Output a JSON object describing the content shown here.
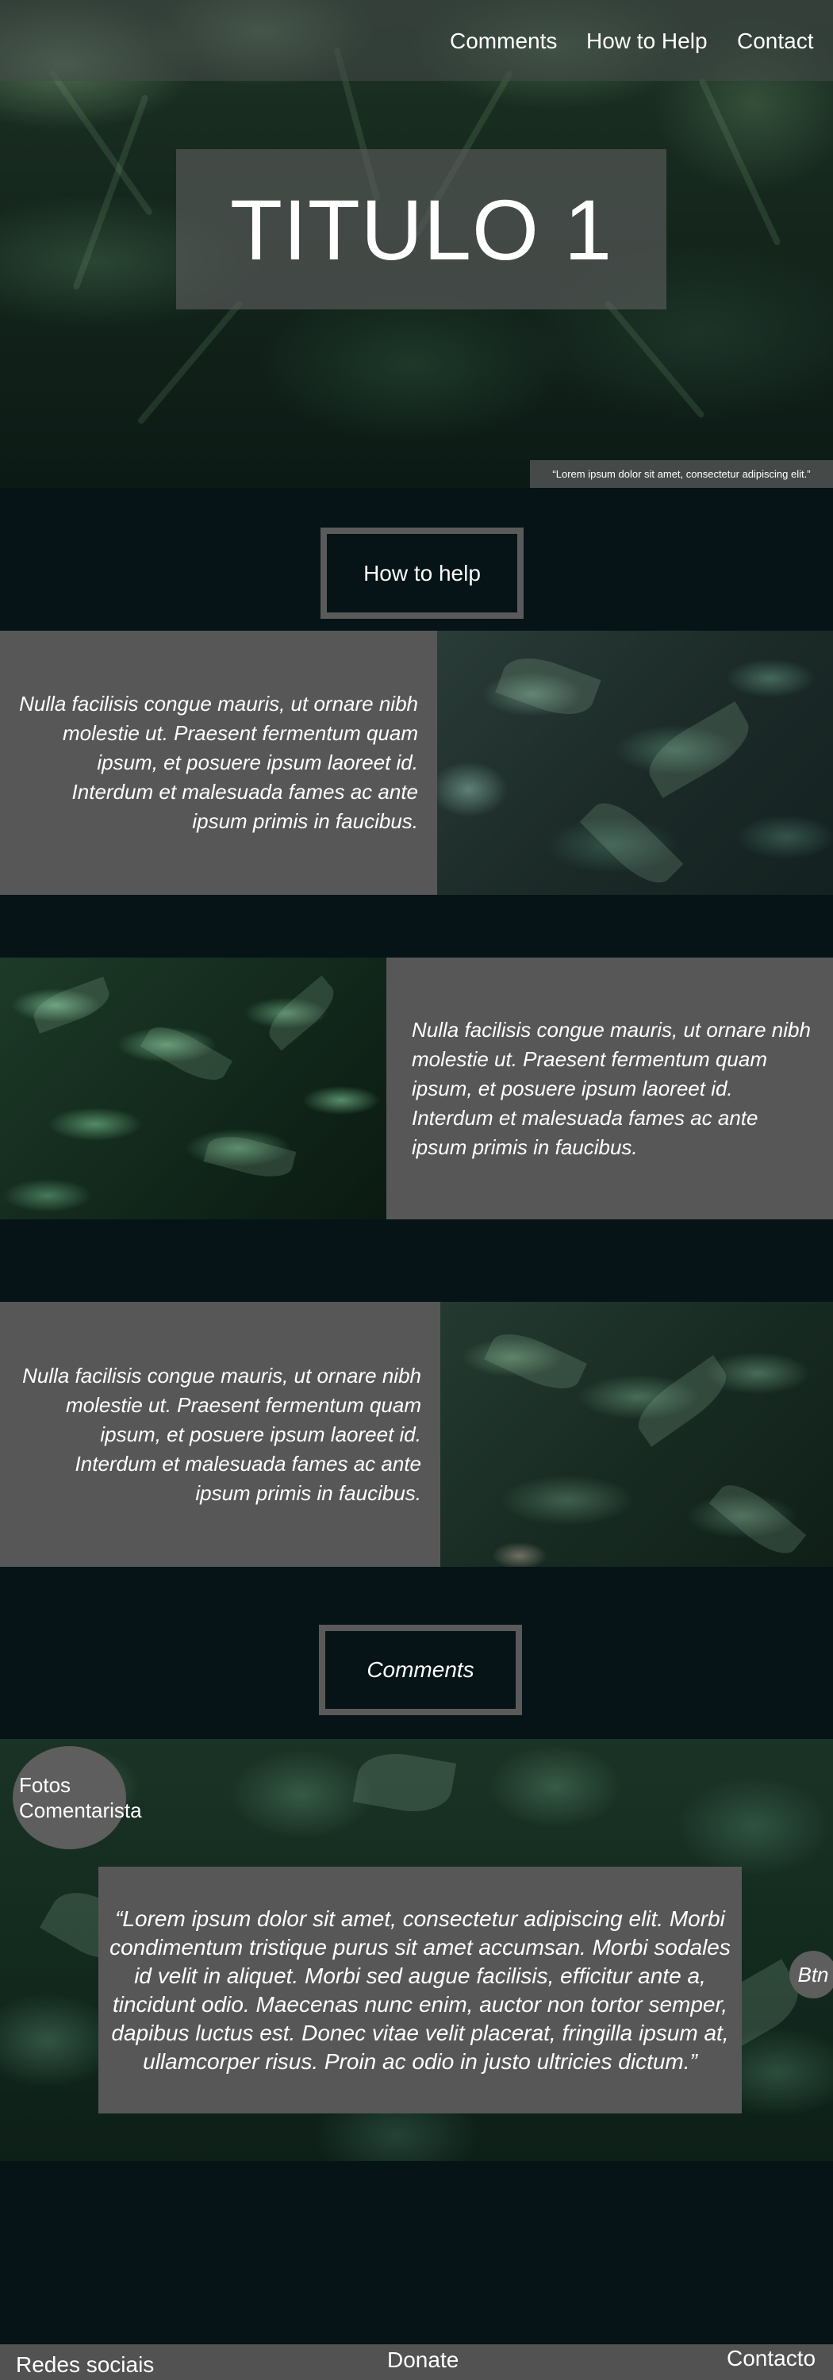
{
  "nav": {
    "comments": "Comments",
    "how_to_help": "How to Help",
    "contact": "Contact"
  },
  "hero": {
    "title": "TITULO 1",
    "caption": "“Lorem ipsum dolor sit amet, consectetur adipiscing elit.”"
  },
  "how_to_help_button": "How to help",
  "features": [
    {
      "text": "Nulla facilisis congue mauris, ut ornare nibh molestie ut. Praesent fermentum quam ipsum, et posuere ipsum laoreet id. Interdum et malesuada fames ac ante ipsum primis in faucibus."
    },
    {
      "text": "Nulla facilisis congue mauris, ut ornare nibh molestie ut. Praesent fermentum quam ipsum, et posuere ipsum laoreet id. Interdum et malesuada fames ac ante ipsum primis in faucibus."
    },
    {
      "text": "Nulla facilisis congue mauris, ut ornare nibh molestie ut. Praesent fermentum quam ipsum, et posuere ipsum laoreet id. Interdum et malesuada fames ac ante ipsum primis in faucibus."
    }
  ],
  "comments_button": "Comments",
  "comments": {
    "commenter_photo_label": "Fotos Comentarista",
    "quote": "“Lorem ipsum dolor sit amet, consectetur adipiscing elit. Morbi condimentum tristique purus sit amet accumsan. Morbi sodales id velit in aliquet. Morbi sed augue facilisis, efficitur ante a, tincidunt odio. Maecenas nunc enim, auctor non tortor semper, dapibus luctus est. Donec vitae velit placerat, fringilla ipsum at, ullamcorper risus. Proin ac odio in justo ultricies dictum.”",
    "button": "Btn"
  },
  "footer": {
    "social": "Redes sociais",
    "donate": "Donate",
    "contact": "Contacto"
  },
  "colors": {
    "page_background": "#061417",
    "panel_gray": "#575757",
    "button_border": "#5a5a5a",
    "footer_gray": "#525252"
  }
}
